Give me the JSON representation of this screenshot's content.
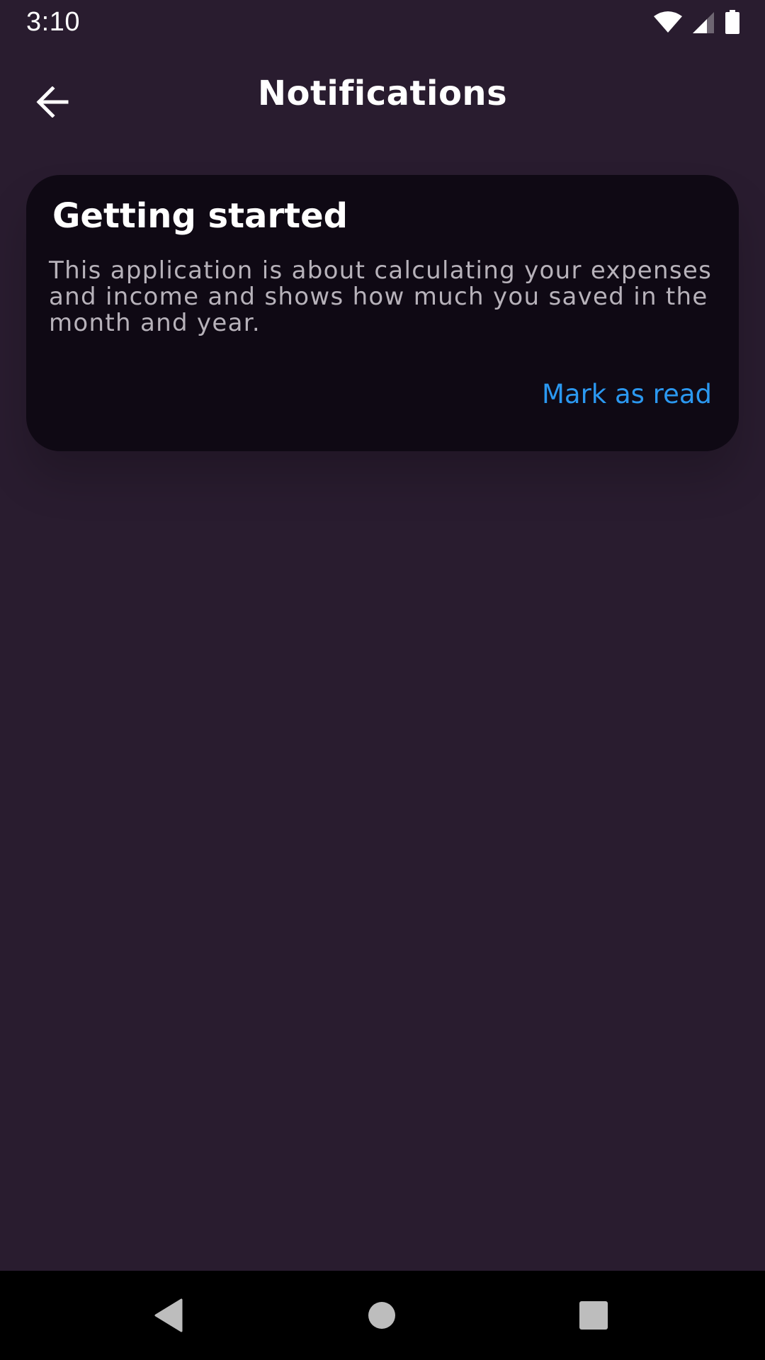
{
  "status_bar": {
    "time": "3:10",
    "icons": [
      "wifi-icon",
      "cell-signal-icon",
      "battery-icon"
    ]
  },
  "app_bar": {
    "title": "Notifications",
    "back_icon": "arrow-left-icon"
  },
  "notifications": [
    {
      "title": "Getting started",
      "body": "This application is about calculating your expenses and income and shows how much you saved in the month and year.",
      "action_label": "Mark as read"
    }
  ],
  "nav_bar": {
    "buttons": [
      "back-triangle-icon",
      "home-circle-icon",
      "recents-square-icon"
    ]
  },
  "colors": {
    "background": "#291c2f",
    "card": "#0f0914",
    "accent": "#2b98f0",
    "body_text": "#b7b2ba"
  }
}
